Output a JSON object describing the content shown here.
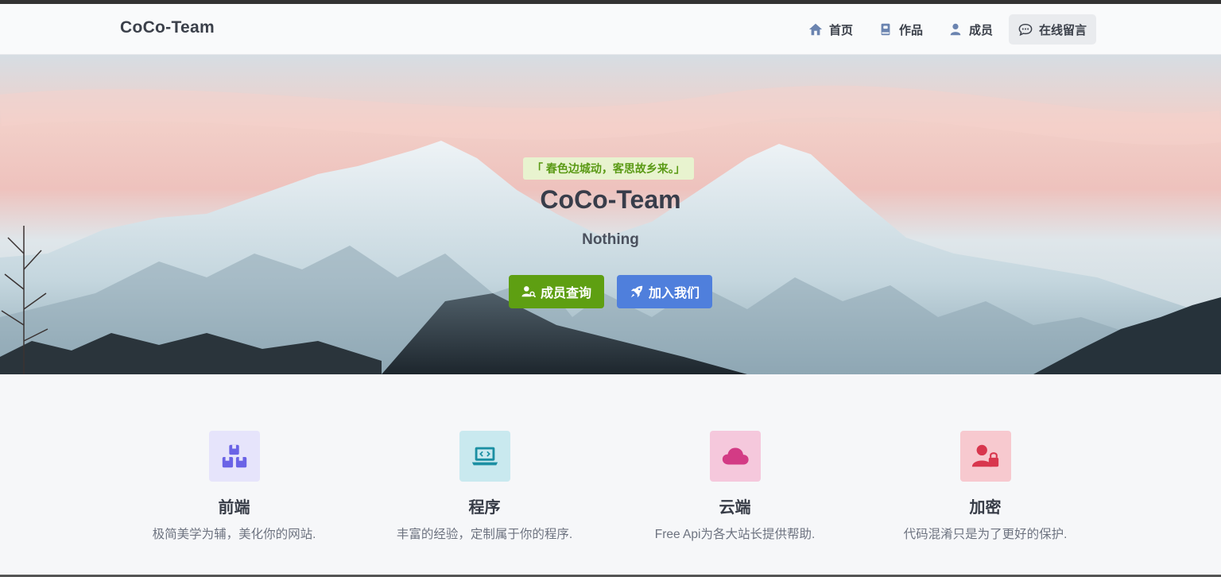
{
  "brand": "CoCo-Team",
  "nav": [
    {
      "label": "首页",
      "icon": "home-icon"
    },
    {
      "label": "作品",
      "icon": "book-icon"
    },
    {
      "label": "成员",
      "icon": "user-icon"
    },
    {
      "label": "在线留言",
      "icon": "chat-icon",
      "active": true
    }
  ],
  "hero": {
    "quote": "「 春色边城动，客思故乡来。」",
    "title": "CoCo-Team",
    "subtitle": "Nothing",
    "buttons": [
      {
        "label": "成员查询",
        "icon": "user-search-icon",
        "color": "#5e9f12"
      },
      {
        "label": "加入我们",
        "icon": "rocket-icon",
        "color": "#4f7fdc"
      }
    ]
  },
  "features": [
    {
      "title": "前端",
      "desc": "极简美学为辅，美化你的网站.",
      "icon": "boxes-icon",
      "icon_color": "#6a63e6",
      "bg": "#e6e4fb"
    },
    {
      "title": "程序",
      "desc": "丰富的经验，定制属于你的程序.",
      "icon": "laptop-code-icon",
      "icon_color": "#1b8fa3",
      "bg": "#c9e9ef"
    },
    {
      "title": "云端",
      "desc": "Free Api为各大站长提供帮助.",
      "icon": "cloud-icon",
      "icon_color": "#d33b85",
      "bg": "#f5c8dc"
    },
    {
      "title": "加密",
      "desc": "代码混淆只是为了更好的保护.",
      "icon": "user-lock-icon",
      "icon_color": "#d8364d",
      "bg": "#f7c9cf"
    }
  ]
}
